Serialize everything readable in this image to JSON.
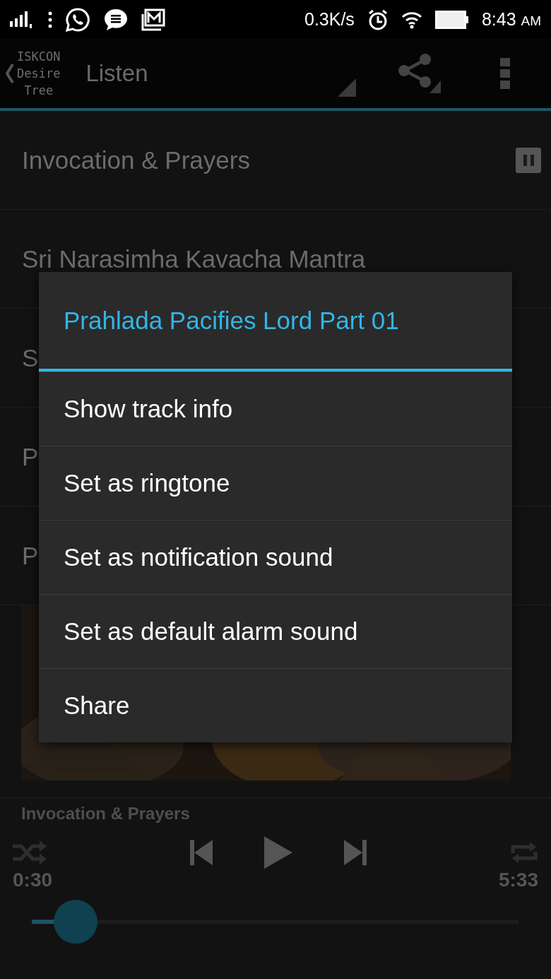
{
  "status_bar": {
    "speed": "0.3K/s",
    "time": "8:43",
    "ampm": "AM"
  },
  "app_bar": {
    "logo_lines": [
      "ISKCON",
      "Desire",
      "Tree"
    ],
    "title": "Listen"
  },
  "tracks": [
    {
      "title": "Invocation & Prayers",
      "playing": true
    },
    {
      "title": "Sri Narasimha Kavacha Mantra",
      "playing": false
    },
    {
      "title": "S",
      "playing": false
    },
    {
      "title": "P",
      "playing": false
    },
    {
      "title": "P",
      "playing": false
    }
  ],
  "player": {
    "title": "Invocation & Prayers",
    "elapsed": "0:30",
    "duration": "5:33",
    "level": 0.09
  },
  "dialog": {
    "title": "Prahlada Pacifies Lord Part 01",
    "items": [
      "Show track info",
      "Set as ringtone",
      "Set as notification sound",
      "Set as default alarm sound",
      "Share"
    ]
  }
}
